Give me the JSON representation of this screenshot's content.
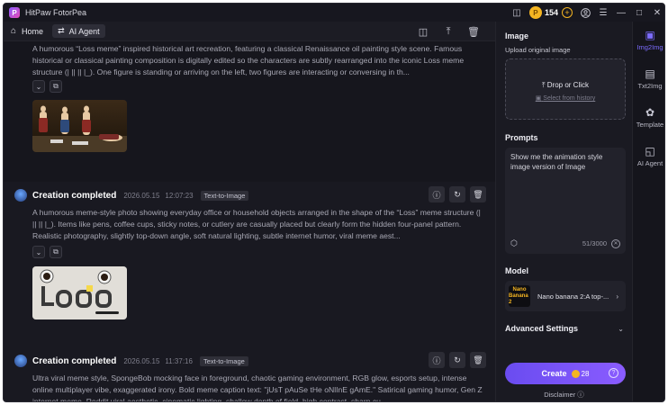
{
  "app": {
    "title": "HitPaw FotorPea",
    "credits": "154"
  },
  "nav": {
    "home_label": "Home",
    "agent_label": "AI Agent"
  },
  "cards": [
    {
      "status": "",
      "description": "A humorous “Loss meme” inspired historical art recreation, featuring a classical Renaissance oil painting style scene. Famous historical or classical painting composition is digitally edited so the characters are subtly rearranged into the iconic Loss meme structure (| || || |_). One figure is standing or arriving on the left, two figures are interacting or conversing in th..."
    },
    {
      "status": "Creation completed",
      "date": "2026.05.15",
      "time": "12:07:23",
      "tag": "Text-to-Image",
      "description": "A humorous meme-style photo showing everyday office or household objects arranged in the shape of the “Loss” meme structure (| || || |_). Items like pens, coffee cups, sticky notes, or cutlery are casually placed but clearly form the hidden four-panel pattern. Realistic photography, slightly top-down angle, soft natural lighting, subtle internet humor, viral meme aest..."
    },
    {
      "status": "Creation completed",
      "date": "2026.05.15",
      "time": "11:37:16",
      "tag": "Text-to-Image",
      "description": "Ultra viral meme style, SpongeBob mocking face in foreground, chaotic gaming environment, RGB glow, esports setup, intense online multiplayer vibe, exaggerated irony. Bold meme caption text: \"jUsT pAuSe tHe oNlInE gAmE.\" Satirical gaming humor, Gen Z internet meme, Reddit viral aesthetic, cinematic lighting, shallow depth of field, high contrast, sharp cu..."
    }
  ],
  "panel": {
    "image_title": "Image",
    "upload_label": "Upload original image",
    "drop_label": "Drop or Click",
    "history_label": "Select from history",
    "prompts_title": "Prompts",
    "prompt_text": "Show me the animation style image version of Image",
    "char_count": "51/3000",
    "model_title": "Model",
    "model_thumb_line1": "Nano",
    "model_thumb_line2": "Banana 2",
    "model_name": "Nano banana 2:A top-...",
    "advanced_label": "Advanced Settings",
    "create_label": "Create",
    "create_cost": "28",
    "disclaimer": "Disclaimer"
  },
  "rail": [
    {
      "label": "Img2Img",
      "icon": "image-edit-icon",
      "active": true
    },
    {
      "label": "Txt2Img",
      "icon": "text-image-icon",
      "active": false
    },
    {
      "label": "Template",
      "icon": "template-icon",
      "active": false
    },
    {
      "label": "AI Agent",
      "icon": "agent-icon",
      "active": false
    }
  ],
  "colors": {
    "accent": "#7c6cff",
    "coin": "#f5b522",
    "background": "#15151c"
  }
}
